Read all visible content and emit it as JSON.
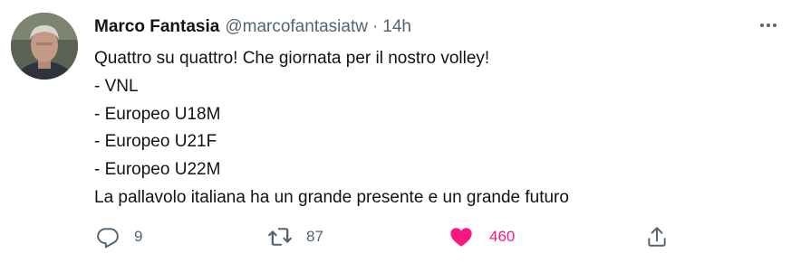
{
  "tweet": {
    "author_name": "Marco Fantasia",
    "author_handle": "@marcofantasiatw",
    "separator": "·",
    "timestamp": "14h",
    "lines": [
      "Quattro su quattro! Che giornata per il nostro volley!",
      "- VNL",
      "- Europeo U18M",
      "- Europeo U21F",
      "- Europeo U22M",
      "La pallavolo italiana ha un grande presente e un grande futuro"
    ]
  },
  "actions": {
    "reply_count": "9",
    "retweet_count": "87",
    "like_count": "460",
    "liked": true
  },
  "icons": {
    "more": "more-icon",
    "reply": "reply-icon",
    "retweet": "retweet-icon",
    "like": "heart-icon",
    "share": "share-icon"
  },
  "colors": {
    "text_primary": "#0f1419",
    "text_secondary": "#536471",
    "like_active": "#f91880"
  }
}
